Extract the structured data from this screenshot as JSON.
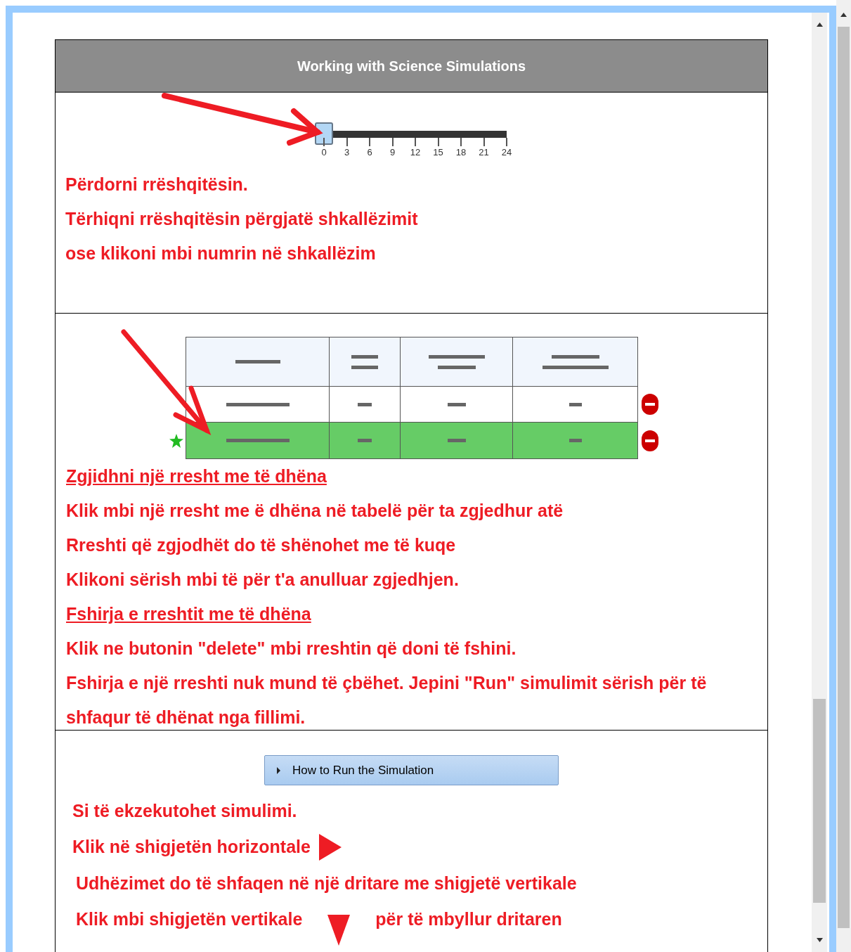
{
  "header": {
    "title": "Working with Science Simulations"
  },
  "slider": {
    "level": 0,
    "ticks": [
      "0",
      "3",
      "6",
      "9",
      "12",
      "15",
      "18",
      "21",
      "24"
    ]
  },
  "slider_section": {
    "lines": [
      {
        "text": "Përdorni rrëshqitësin."
      },
      {
        "text": "Tërhiqni rrëshqitësin përgjatë shkallëzimit"
      },
      {
        "text": "ose klikoni mbi numrin në shkallëzim"
      }
    ]
  },
  "table": {
    "rows": [
      {
        "selected": false
      },
      {
        "selected": true
      }
    ]
  },
  "table_section": {
    "lines": [
      {
        "kind": "heading",
        "text": "Zgjidhni një rresht me të dhëna"
      },
      {
        "kind": "text",
        "text": "Klik mbi një rresht me ë dhëna në tabelë për ta zgjedhur atë"
      },
      {
        "kind": "text",
        "text": "Rreshti që zgjodhët do të shënohet me të kuqe"
      },
      {
        "kind": "text",
        "text": "Klikoni sërish mbi të për t'a anulluar zgjedhjen."
      },
      {
        "kind": "heading",
        "text": "Fshirja e rreshtit me të dhëna"
      },
      {
        "kind": "text",
        "text": "Klik ne butonin \"delete\" mbi rreshtin që doni të fshini."
      },
      {
        "kind": "text",
        "text": "Fshirja e një rreshti nuk mund të çbëhet. Jepini \"Run\" simulimit sërish për të shfaqur të dhënat nga fillimi."
      }
    ]
  },
  "run_section": {
    "button": "How to Run the Simulation",
    "expanded": false,
    "lines": [
      {
        "kind": "text",
        "text": "Si të ekzekutohet simulimi."
      },
      {
        "kind": "right_arrow",
        "text": "Klik në shigjetën horizontale"
      },
      {
        "kind": "text",
        "text": "Udhëzimet do të shfaqen në një dritare me shigjetë vertikale"
      },
      {
        "kind": "down_arrow",
        "text": "Klik mbi shigjetën vertikale",
        "after": "për të mbyllur dritaren"
      }
    ]
  }
}
